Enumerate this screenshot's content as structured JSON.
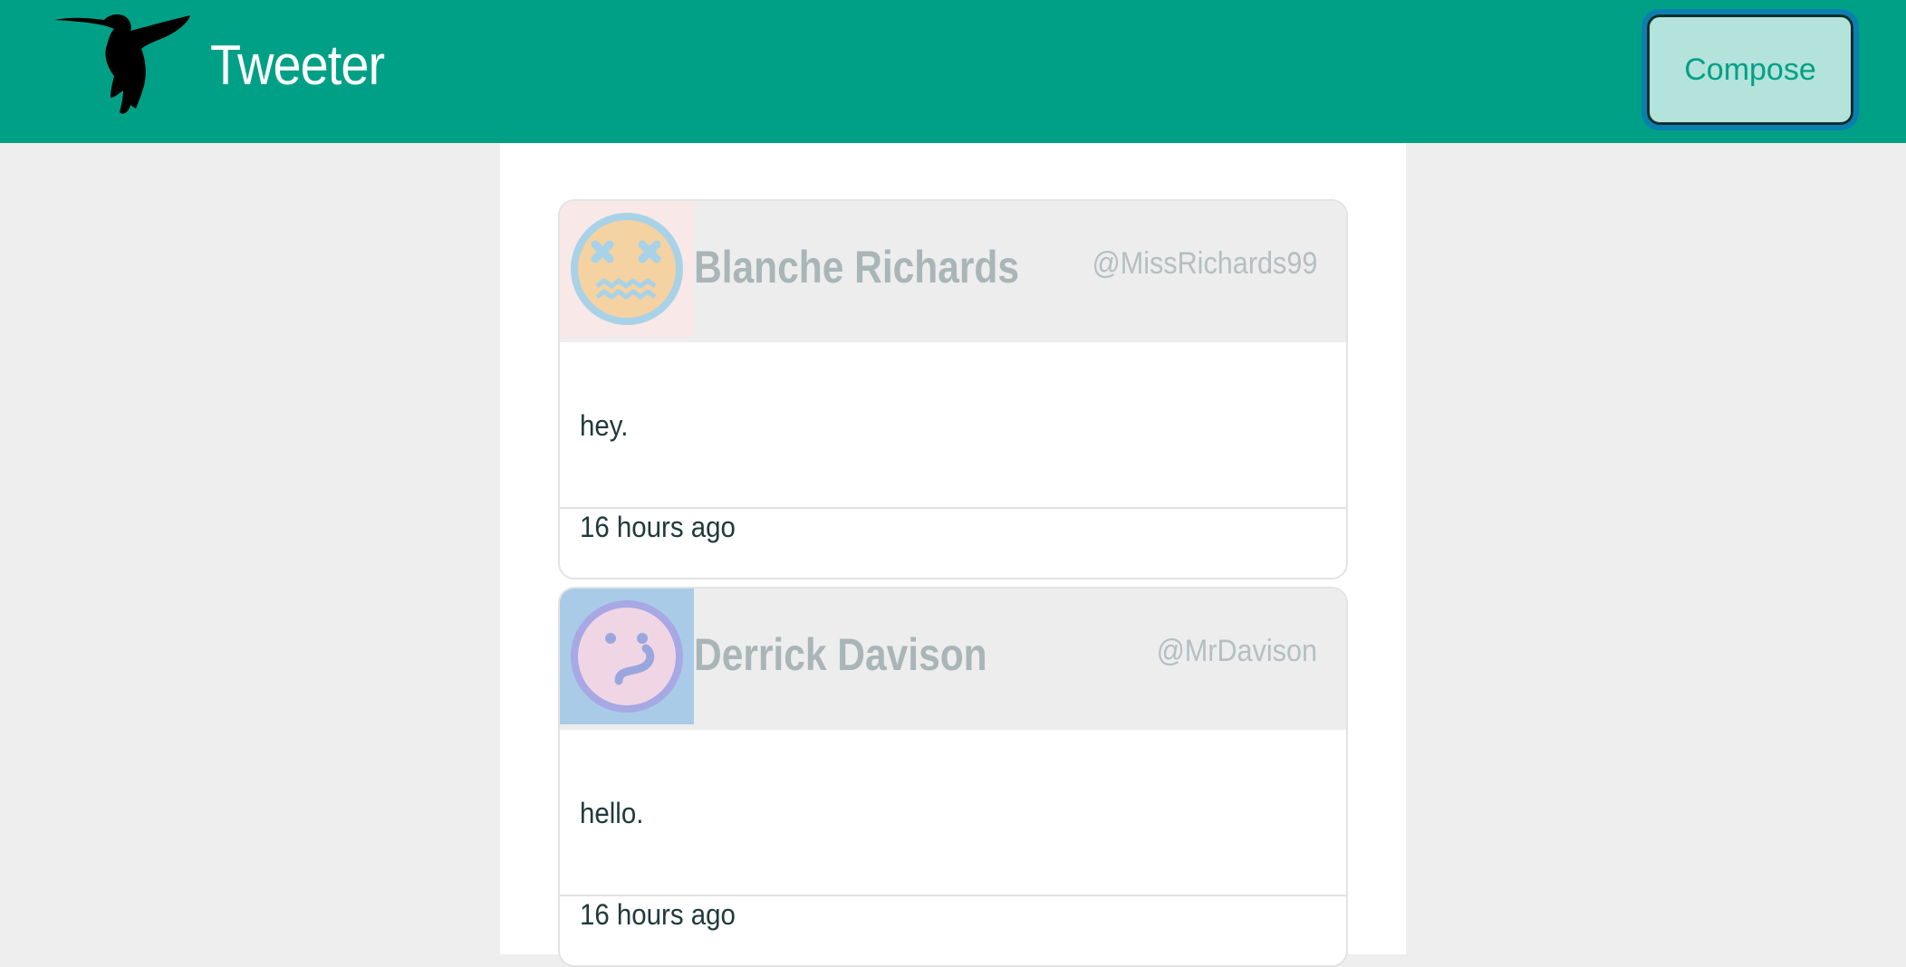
{
  "navbar": {
    "title": "Tweeter",
    "logo_icon": "hummingbird-icon",
    "compose_label": "Compose",
    "colors": {
      "bar": "#00a087",
      "compose_bg": "#b3e3da",
      "compose_outline": "#0b7fb0"
    }
  },
  "tweets": [
    {
      "name": "Blanche Richards",
      "handle": "@MissRichards99",
      "text": "hey.",
      "time": "16 hours ago",
      "avatar_icon": "dizzy-face-avatar-icon",
      "avatar_bg": "#f8e8e8"
    },
    {
      "name": "Derrick Davison",
      "handle": "@MrDavison",
      "text": "hello.",
      "time": "16 hours ago",
      "avatar_icon": "confused-face-avatar-icon",
      "avatar_bg": "#a9cbe8"
    }
  ]
}
